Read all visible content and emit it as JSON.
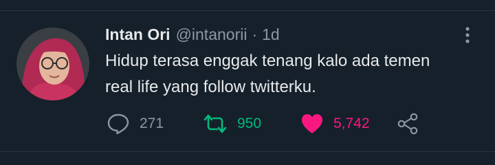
{
  "tweet": {
    "author": {
      "display_name": "Intan Ori",
      "handle": "@intanorii"
    },
    "separator": "·",
    "time": "1d",
    "text_lines": [
      "Hidup terasa enggak tenang kalo ada temen",
      "real life yang follow twitterku."
    ],
    "actions": {
      "reply": {
        "icon": "reply-icon",
        "count": "271"
      },
      "retweet": {
        "icon": "retweet-icon",
        "count": "950",
        "active": true
      },
      "like": {
        "icon": "heart-icon",
        "count": "5,742",
        "active": true
      },
      "share": {
        "icon": "share-icon"
      }
    },
    "more_icon": "more-vertical-icon"
  },
  "colors": {
    "background": "#15202b",
    "text_primary": "#e7e9ea",
    "text_secondary": "#8b98a5",
    "retweet_active": "#00ba7c",
    "like_active": "#f91880",
    "divider": "#2b3640"
  }
}
